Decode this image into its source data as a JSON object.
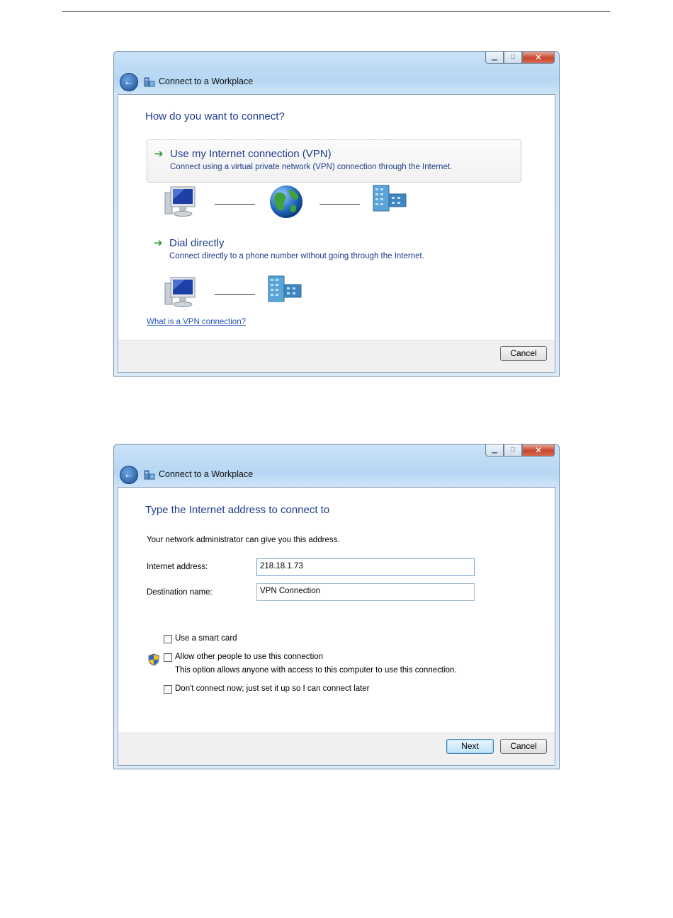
{
  "window1": {
    "title": "Connect to a Workplace",
    "heading": "How do you want to connect?",
    "option_vpn": {
      "title": "Use my Internet connection (VPN)",
      "description": "Connect using a virtual private network (VPN) connection through the Internet."
    },
    "option_dial": {
      "title": "Dial directly",
      "description": "Connect directly to a phone number without going through the Internet."
    },
    "help_link": "What is a VPN connection?",
    "cancel_label": "Cancel"
  },
  "window2": {
    "title": "Connect to a Workplace",
    "heading": "Type the Internet address to connect to",
    "instruction": "Your network administrator can give you this address.",
    "internet_address_label": "Internet address:",
    "internet_address_value": "218.18.1.73",
    "destination_name_label": "Destination name:",
    "destination_name_value": "VPN Connection",
    "checkbox_smart_card": "Use a smart card",
    "checkbox_allow_others": "Allow other people to use this connection",
    "allow_others_note": "This option allows anyone with access to this computer to use this connection.",
    "checkbox_dont_connect": "Don't connect now; just set it up so I can connect later",
    "next_label": "Next",
    "cancel_label": "Cancel"
  },
  "icons": {
    "back": "back-arrow-icon",
    "network": "network-icon",
    "arrow": "green-arrow-icon",
    "computer": "computer-icon",
    "globe": "globe-icon",
    "building": "building-icon",
    "shield": "uac-shield-icon"
  }
}
